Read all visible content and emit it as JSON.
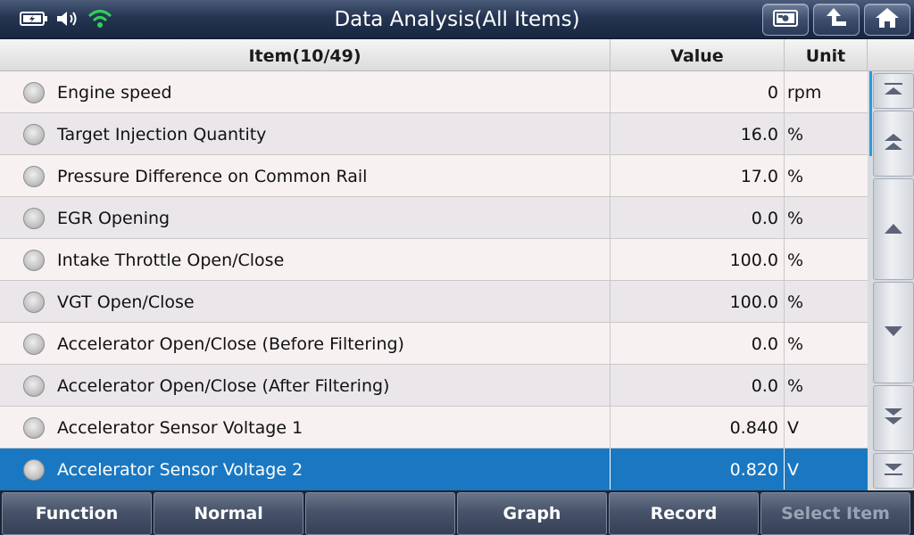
{
  "header": {
    "title": "Data Analysis(All Items)",
    "icons": [
      "battery-icon",
      "speaker-icon",
      "wifi-icon"
    ],
    "buttons": [
      "screenshot-icon",
      "back-icon",
      "home-icon"
    ]
  },
  "table": {
    "columns": {
      "item": "Item(10/49)",
      "value": "Value",
      "unit": "Unit"
    },
    "rows": [
      {
        "name": "Engine speed",
        "value": "0",
        "unit": "rpm"
      },
      {
        "name": "Target Injection Quantity",
        "value": "16.0",
        "unit": "%"
      },
      {
        "name": "Pressure Difference on Common Rail",
        "value": "17.0",
        "unit": "%"
      },
      {
        "name": "EGR Opening",
        "value": "0.0",
        "unit": "%"
      },
      {
        "name": "Intake Throttle Open/Close",
        "value": "100.0",
        "unit": "%"
      },
      {
        "name": "VGT Open/Close",
        "value": "100.0",
        "unit": "%"
      },
      {
        "name": "Accelerator Open/Close (Before Filtering)",
        "value": "0.0",
        "unit": "%"
      },
      {
        "name": "Accelerator Open/Close (After Filtering)",
        "value": "0.0",
        "unit": "%"
      },
      {
        "name": "Accelerator Sensor Voltage 1",
        "value": "0.840",
        "unit": "V"
      },
      {
        "name": "Accelerator Sensor Voltage 2",
        "value": "0.820",
        "unit": "V"
      }
    ],
    "selected_row": 9
  },
  "scroll": {
    "buttons": [
      "scroll-top-icon",
      "page-up-icon",
      "line-up-icon",
      "line-down-icon",
      "page-down-icon",
      "scroll-bottom-icon"
    ]
  },
  "toolbar": {
    "buttons": [
      {
        "label": "Function"
      },
      {
        "label": "Normal"
      },
      {
        "label": ""
      },
      {
        "label": "Graph"
      },
      {
        "label": "Record"
      },
      {
        "label": "Select Item"
      }
    ]
  },
  "colors": {
    "selected": "#1a78c2",
    "title_bar": "#243552",
    "scroll_indicator": "#2a9ae0"
  }
}
